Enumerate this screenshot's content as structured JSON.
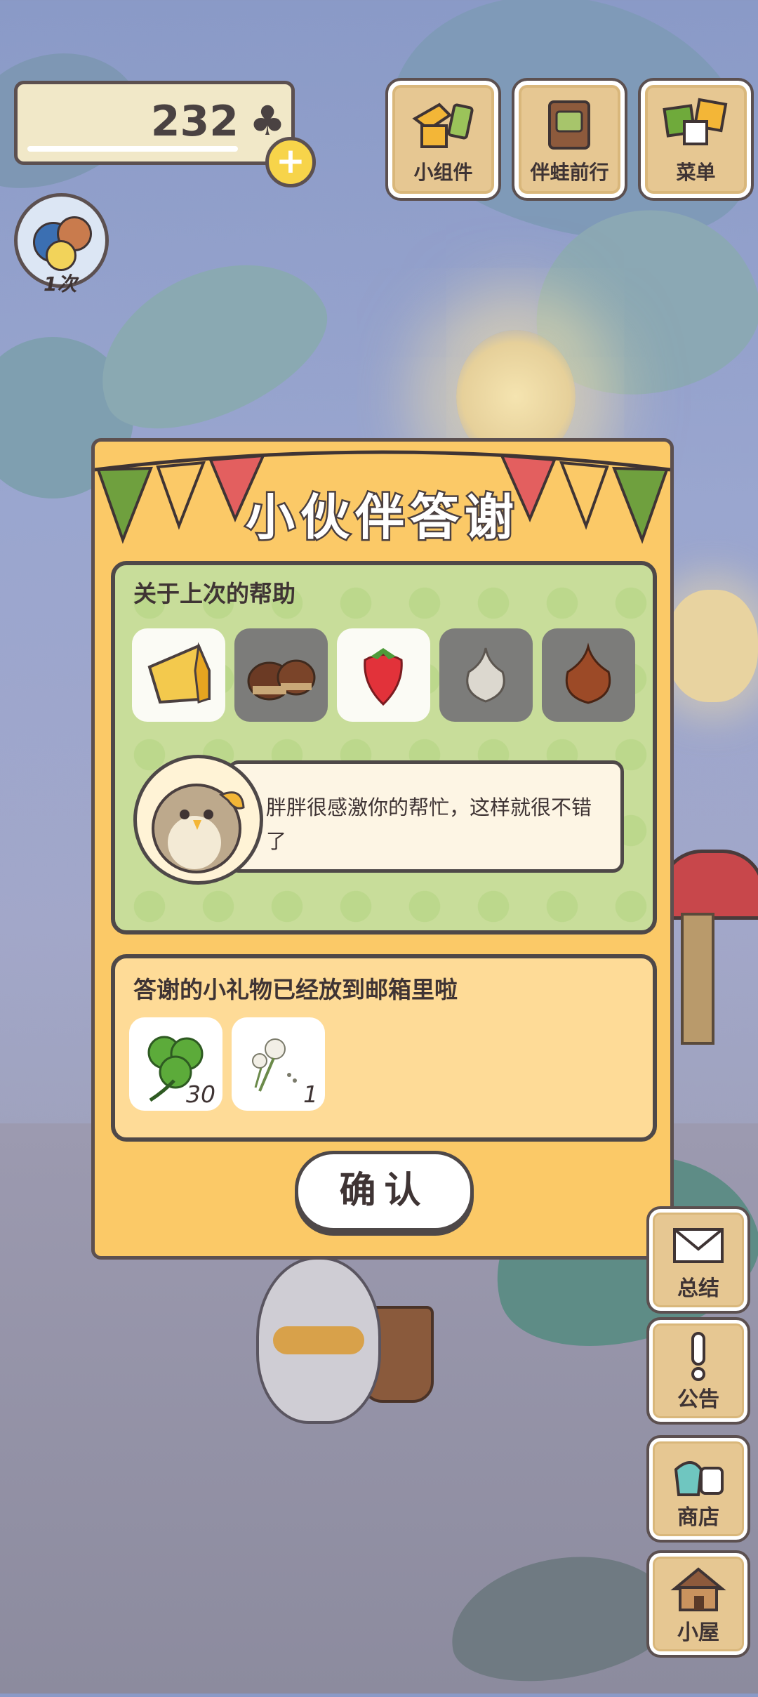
{
  "hud": {
    "clover_count": "232",
    "plus_label": "+",
    "top_buttons": [
      {
        "label": "小组件",
        "icon": "widget-icon"
      },
      {
        "label": "伴蛙前行",
        "icon": "journey-book-icon"
      },
      {
        "label": "菜单",
        "icon": "menu-cards-icon"
      }
    ],
    "visitor_count": "1次"
  },
  "modal": {
    "title": "小伙伴答谢",
    "help_section": {
      "heading": "关于上次的帮助",
      "items": [
        {
          "name": "cheese",
          "state": "received"
        },
        {
          "name": "chestnut",
          "state": "not-received"
        },
        {
          "name": "strawberry",
          "state": "received"
        },
        {
          "name": "garlic",
          "state": "not-received"
        },
        {
          "name": "onion",
          "state": "not-received"
        }
      ],
      "message": "胖胖很感激你的帮忙，这样就很不错了"
    },
    "gift_section": {
      "heading": "答谢的小礼物已经放到邮箱里啦",
      "gifts": [
        {
          "name": "clover",
          "qty": "30"
        },
        {
          "name": "dandelion",
          "qty": "1"
        }
      ]
    },
    "confirm_label": "确认"
  },
  "side_buttons": [
    {
      "label": "总结",
      "icon": "letter-icon"
    },
    {
      "label": "公告",
      "icon": "exclamation-icon"
    },
    {
      "label": "商店",
      "icon": "shop-bags-icon"
    },
    {
      "label": "小屋",
      "icon": "house-icon"
    }
  ],
  "colors": {
    "modal_bg": "#fbc967",
    "help_panel_bg": "#c8dd9a",
    "gift_panel_bg": "#fedb97",
    "outline": "#4e4848",
    "button_wood": "#e6c792"
  }
}
